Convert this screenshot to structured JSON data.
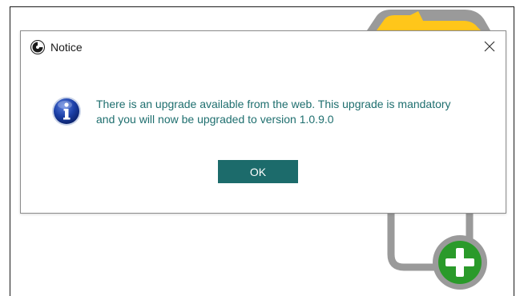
{
  "dialog": {
    "title": "Notice",
    "app_icon": "app-logo-icon",
    "close_icon": "close-icon",
    "info_icon": "info-icon",
    "message_line1": "There is an upgrade available from the web. This upgrade is mandatory",
    "message_line2": "and you will now be upgraded to version 1.0.9.0",
    "ok_label": "OK"
  },
  "background": {
    "add_icon": "plus-circle-icon",
    "folder_icon": "folder-icon"
  },
  "colors": {
    "message_text": "#1f6f6f",
    "ok_button": "#1c6b6b",
    "info_icon_blue": "#1b3fa6",
    "add_icon_green": "#2a9a2a",
    "folder_yellow": "#ffc61a",
    "connector_gray": "#9a9a9a"
  }
}
